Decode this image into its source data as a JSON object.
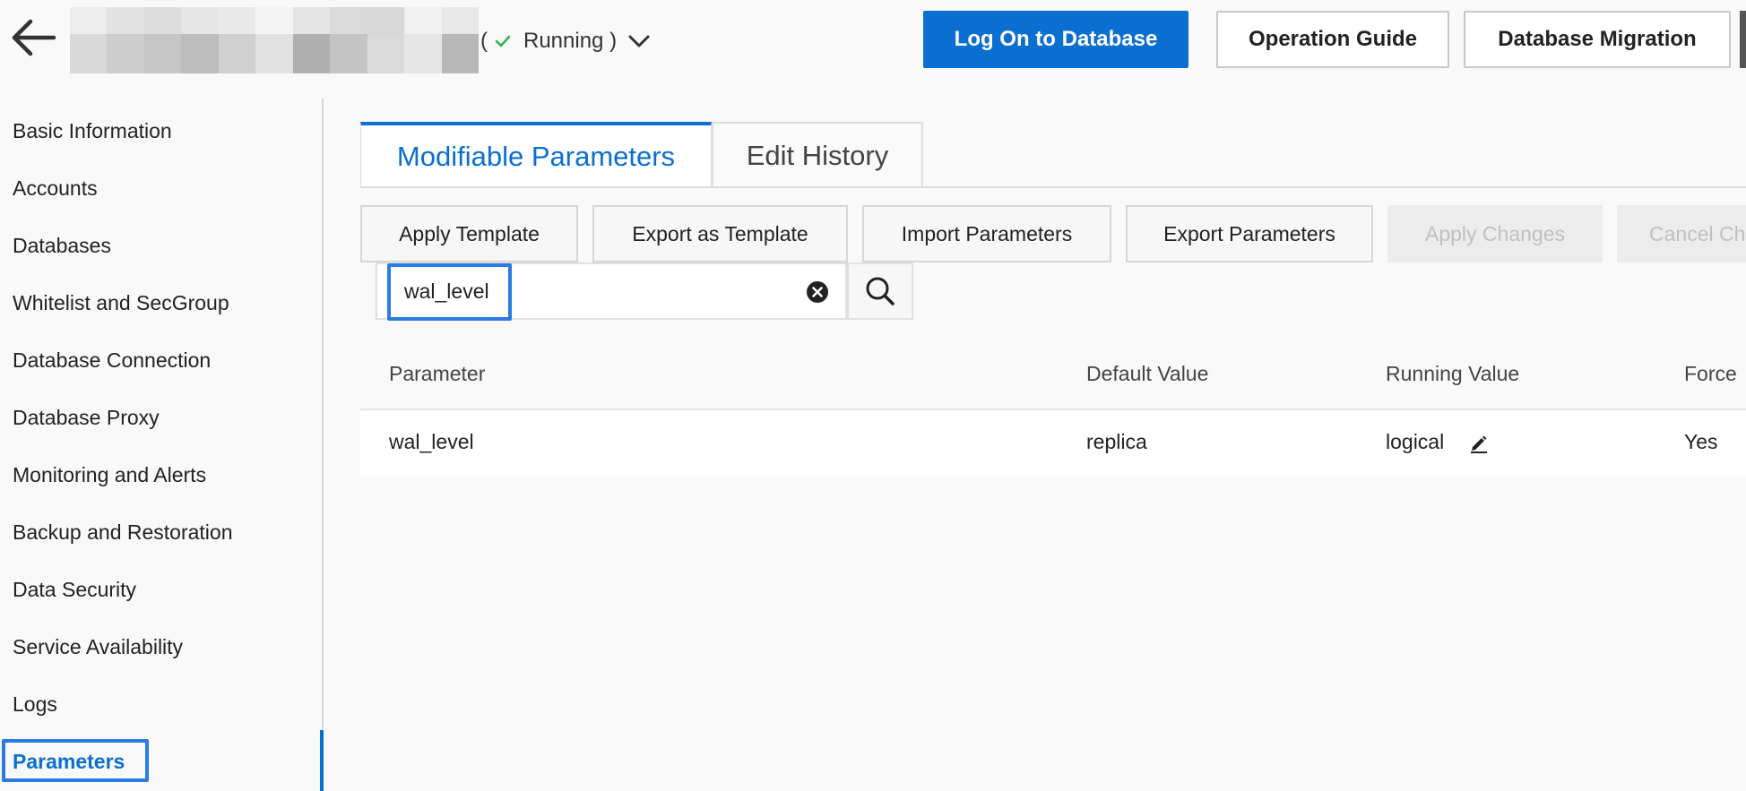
{
  "header": {
    "back_label": "Back",
    "status_paren_open": "(",
    "status_text": "Running )",
    "status_color": "#2db54a",
    "buttons": {
      "login": "Log On to Database",
      "guide": "Operation Guide",
      "migration": "Database Migration"
    }
  },
  "sidebar": {
    "items": [
      {
        "label": "Basic Information"
      },
      {
        "label": "Accounts"
      },
      {
        "label": "Databases"
      },
      {
        "label": "Whitelist and SecGroup"
      },
      {
        "label": "Database Connection"
      },
      {
        "label": "Database Proxy"
      },
      {
        "label": "Monitoring and Alerts"
      },
      {
        "label": "Backup and Restoration"
      },
      {
        "label": "Data Security"
      },
      {
        "label": "Service Availability"
      },
      {
        "label": "Logs"
      },
      {
        "label": "Parameters"
      }
    ],
    "active": "Parameters"
  },
  "tabs": {
    "modifiable": "Modifiable Parameters",
    "history": "Edit History"
  },
  "toolbar": {
    "apply_template": "Apply Template",
    "export_template": "Export as Template",
    "import_params": "Import Parameters",
    "export_params": "Export Parameters",
    "apply_changes": "Apply Changes",
    "cancel_changes": "Cancel Ch"
  },
  "search": {
    "value": "wal_level"
  },
  "table": {
    "headers": {
      "parameter": "Parameter",
      "default": "Default Value",
      "running": "Running Value",
      "force": "Force"
    },
    "rows": [
      {
        "parameter": "wal_level",
        "default": "replica",
        "running": "logical",
        "force": "Yes"
      }
    ]
  },
  "colors": {
    "accent": "#0a6fd1",
    "highlight": "#2a7be4"
  }
}
